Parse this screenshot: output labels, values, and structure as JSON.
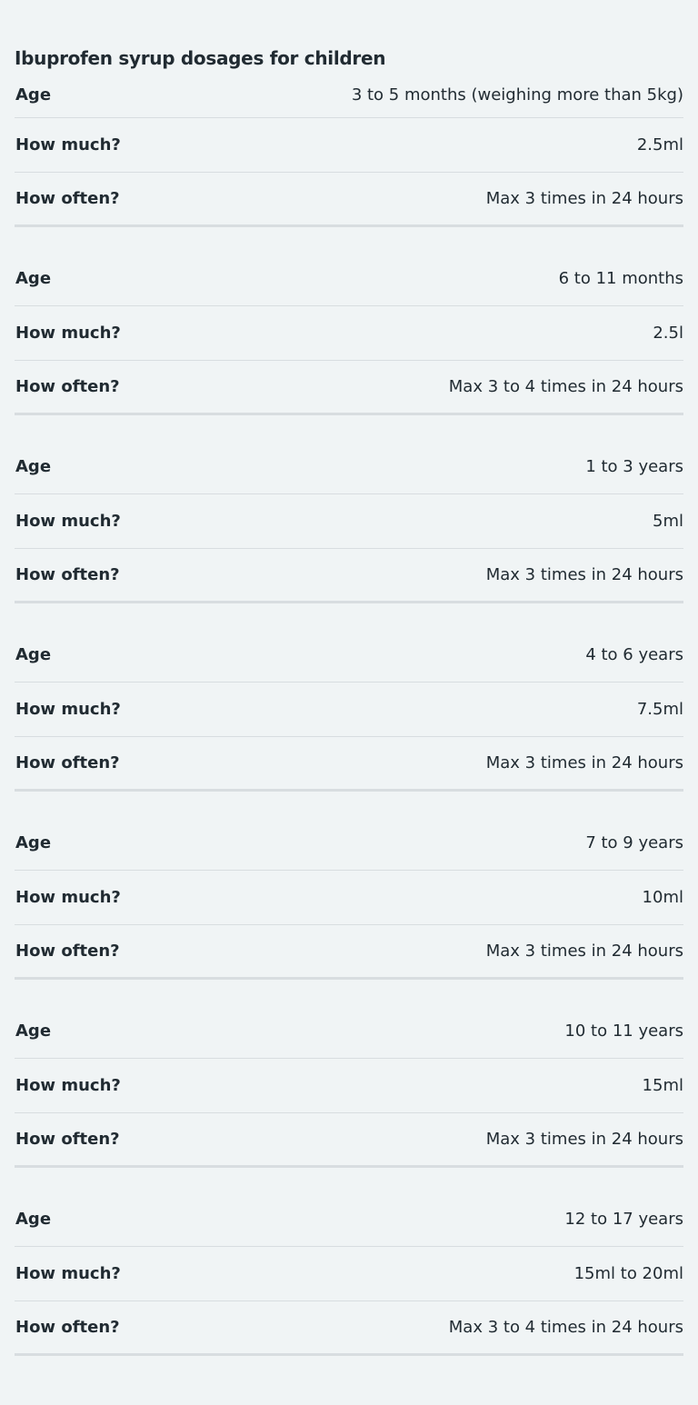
{
  "table": {
    "caption": "Ibuprofen syrup dosages for children",
    "labels": {
      "age": "Age",
      "how_much": "How much?",
      "how_often": "How often?"
    },
    "rows": [
      {
        "age": "3 to 5 months (weighing more than 5kg)",
        "how_much": "2.5ml",
        "how_often": "Max 3 times in 24 hours"
      },
      {
        "age": "6 to 11 months",
        "how_much": "2.5l",
        "how_often": "Max 3 to 4 times in 24 hours"
      },
      {
        "age": "1 to 3 years",
        "how_much": "5ml",
        "how_often": "Max 3 times in 24 hours"
      },
      {
        "age": "4 to 6 years",
        "how_much": "7.5ml",
        "how_often": "Max 3 times in 24 hours"
      },
      {
        "age": "7 to 9 years",
        "how_much": "10ml",
        "how_often": "Max 3 times in 24 hours"
      },
      {
        "age": "10 to 11 years",
        "how_much": "15ml",
        "how_often": "Max 3 times in 24 hours"
      },
      {
        "age": "12 to 17 years",
        "how_much": "15ml to 20ml",
        "how_often": "Max 3 to 4 times in 24 hours"
      }
    ]
  }
}
